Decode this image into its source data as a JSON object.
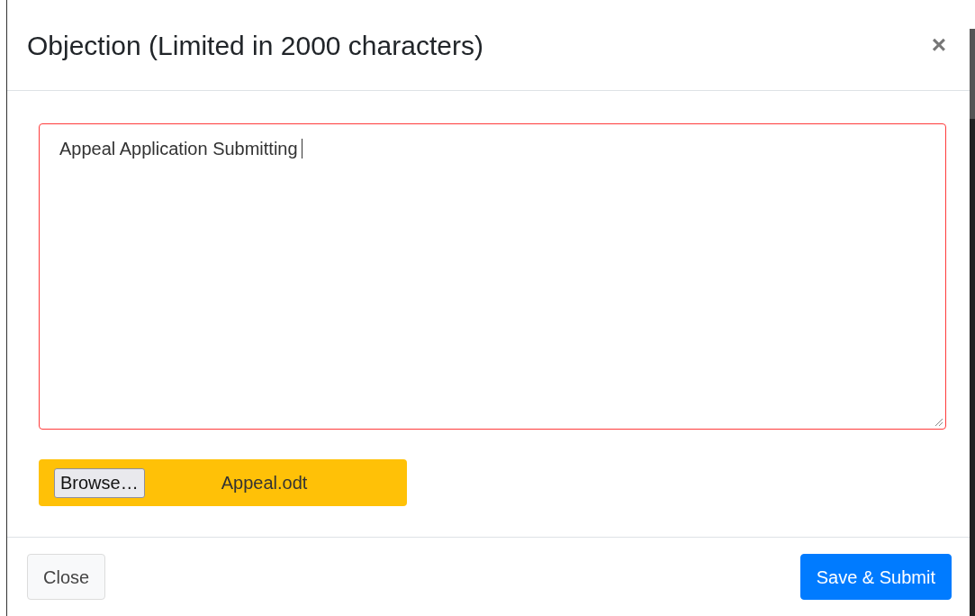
{
  "dialog": {
    "title": "Objection (Limited in 2000 characters)",
    "close_icon": "×"
  },
  "objection_field": {
    "value": "Appeal Application Submitting",
    "invalid": true
  },
  "file_input": {
    "button": "Browse…",
    "file_name": "Appeal.odt"
  },
  "footer": {
    "buttons": [
      {
        "label": "Close",
        "kind": "secondary"
      },
      {
        "label": "Save & Submit",
        "kind": "primary"
      }
    ]
  }
}
